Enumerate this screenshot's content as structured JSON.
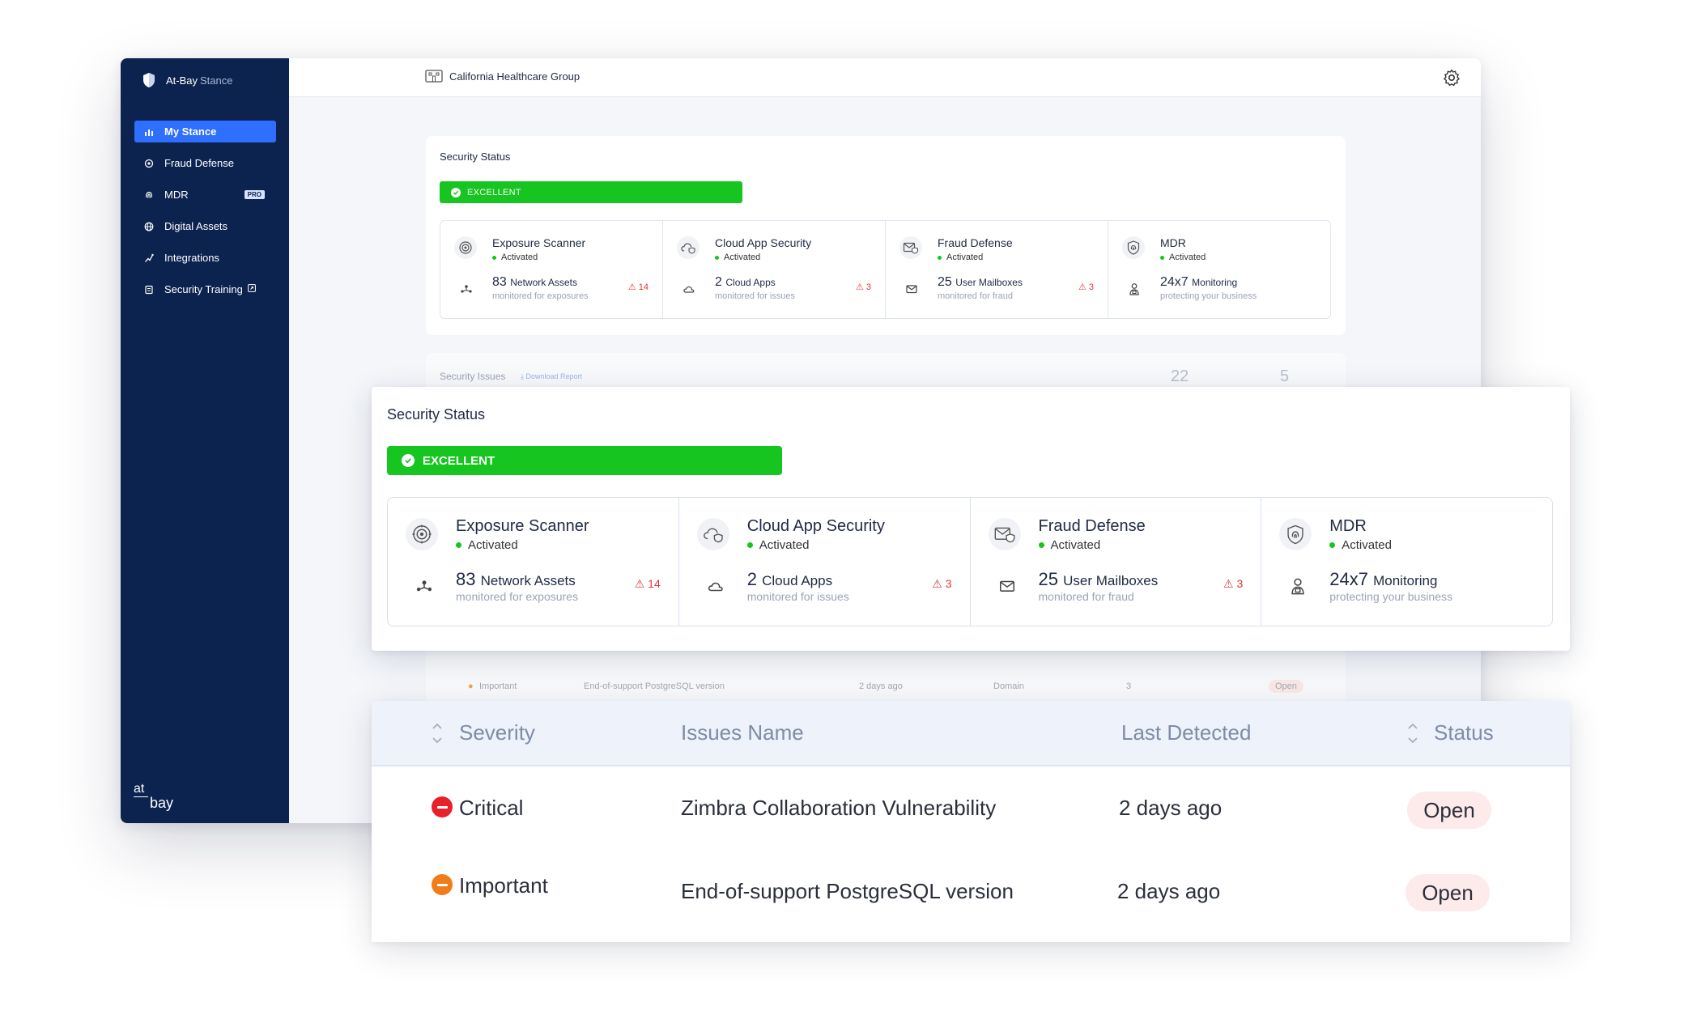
{
  "app": {
    "brand_name": "At-Bay",
    "brand_product": "Stance",
    "org_name": "California Healthcare Group",
    "footer_logo_top": "at",
    "footer_logo_bottom": "bay"
  },
  "sidebar": {
    "items": [
      {
        "label": "My Stance",
        "icon": "chart-icon",
        "active": true
      },
      {
        "label": "Fraud Defense",
        "icon": "fraud-icon"
      },
      {
        "label": "MDR",
        "icon": "fingerprint-icon",
        "badge": "PRO"
      },
      {
        "label": "Digital Assets",
        "icon": "globe-icon"
      },
      {
        "label": "Integrations",
        "icon": "integrations-icon"
      },
      {
        "label": "Security Training",
        "icon": "training-icon",
        "external_icon": "external-link-icon"
      }
    ]
  },
  "security_status": {
    "title": "Security Status",
    "rating": "EXCELLENT",
    "rating_color": "#17c520",
    "tiles": [
      {
        "name": "Exposure Scanner",
        "status": "Activated",
        "metric_value": "83",
        "metric_label": "Network Assets",
        "metric_sub": "monitored for exposures",
        "warning_count": "14",
        "icon": "scanner-icon",
        "metric_icon": "network-icon"
      },
      {
        "name": "Cloud App Security",
        "status": "Activated",
        "metric_value": "2",
        "metric_label": "Cloud Apps",
        "metric_sub": "monitored for issues",
        "warning_count": "3",
        "icon": "cloud-shield-icon",
        "metric_icon": "cloud-icon"
      },
      {
        "name": "Fraud Defense",
        "status": "Activated",
        "metric_value": "25",
        "metric_label": "User Mailboxes",
        "metric_sub": "monitored for fraud",
        "warning_count": "3",
        "icon": "mail-shield-icon",
        "metric_icon": "mail-icon"
      },
      {
        "name": "MDR",
        "status": "Activated",
        "metric_value": "24x7",
        "metric_label": "Monitoring",
        "metric_sub": "protecting your business",
        "warning_count": "",
        "icon": "shield-fingerprint-icon",
        "metric_icon": "agent-icon"
      }
    ]
  },
  "security_issues": {
    "title": "Security Issues",
    "download_label": "Download Report",
    "count_a": "22",
    "count_b": "5",
    "ghost_row": {
      "severity": "Important",
      "name": "End-of-support PostgreSQL version",
      "detected": "2 days ago",
      "type": "Domain",
      "count": "3",
      "status": "Open"
    }
  },
  "issues_table": {
    "columns": [
      "Severity",
      "Issues Name",
      "Last Detected",
      "Status"
    ],
    "rows": [
      {
        "severity": "Critical",
        "severity_color": "#e8202a",
        "name": "Zimbra Collaboration Vulnerability",
        "detected": "2 days ago",
        "status": "Open"
      },
      {
        "severity": "Important",
        "severity_color": "#f07d19",
        "name": "End-of-support PostgreSQL version",
        "detected": "2 days ago",
        "status": "Open"
      }
    ]
  }
}
